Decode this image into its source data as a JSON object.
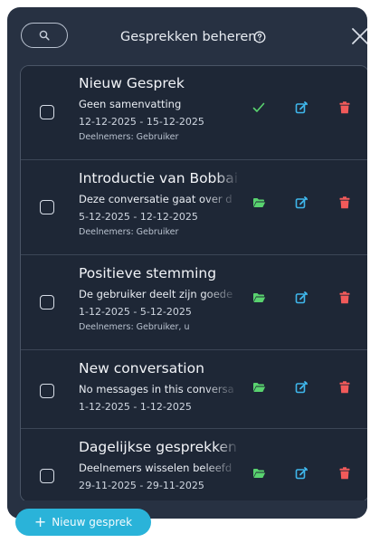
{
  "header": {
    "title": "Gesprekken beheren",
    "search_icon": "search-icon",
    "help_icon": "question-circle-icon",
    "close_icon": "close-icon"
  },
  "conversations": [
    {
      "title": "Nieuw Gesprek",
      "summary": "Geen samenvatting",
      "dates": "12-12-2025 - 15-12-2025",
      "members": "Deelnemers: Gebruiker",
      "primary_action_icon": "check-icon"
    },
    {
      "title": "Introductie van Bobbai",
      "summary": "Deze conversatie gaat over d",
      "dates": "5-12-2025 - 12-12-2025",
      "members": "Deelnemers: Gebruiker",
      "primary_action_icon": "folder-open-icon"
    },
    {
      "title": "Positieve stemming",
      "summary": "De gebruiker deelt zijn goede",
      "dates": "1-12-2025 - 5-12-2025",
      "members": "Deelnemers: Gebruiker, u",
      "primary_action_icon": "folder-open-icon"
    },
    {
      "title": "New conversation",
      "summary": "No messages in this conversa",
      "dates": "1-12-2025 - 1-12-2025",
      "members": "",
      "primary_action_icon": "folder-open-icon"
    },
    {
      "title": "Dagelijkse gesprekken",
      "summary": "Deelnemers wisselen beleefd",
      "dates": "29-11-2025 - 29-11-2025",
      "members": "",
      "primary_action_icon": "folder-open-icon"
    }
  ],
  "footer": {
    "new_button_label": "Nieuw gesprek",
    "new_button_icon": "plus-icon"
  },
  "colors": {
    "panel_bg": "#273142",
    "card_bg": "#1e2736",
    "accent": "#2ab3d9",
    "green": "#59d36f",
    "blue": "#3fb7ec",
    "red": "#f15a5a"
  }
}
